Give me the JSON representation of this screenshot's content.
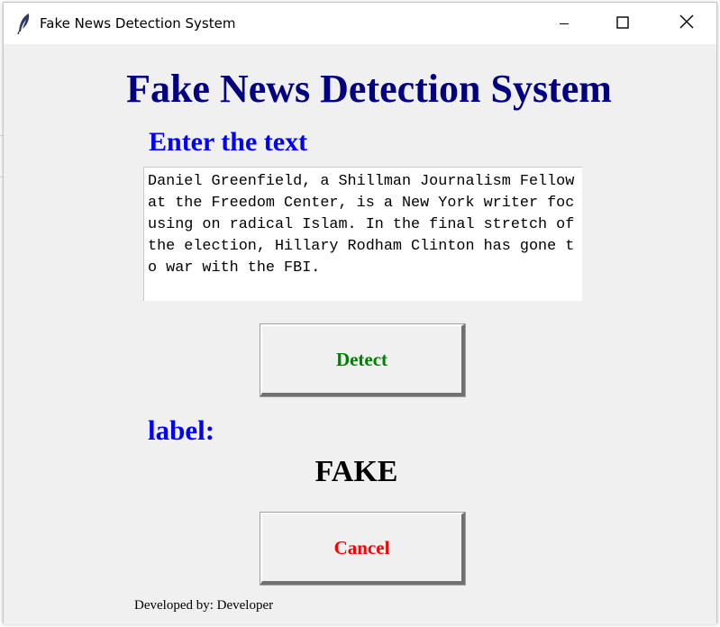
{
  "window": {
    "title": "Fake News Detection System",
    "minimize_icon": "minimize-icon",
    "maximize_icon": "maximize-icon",
    "close_icon": "close-icon",
    "app_icon": "feather-icon"
  },
  "app": {
    "heading": "Fake News Detection System",
    "input_label": "Enter the text",
    "input_text": "Daniel Greenfield, a Shillman Journalism Fellow at the Freedom Center, is a New York writer focusing on radical Islam. In the final stretch of the election, Hillary Rodham Clinton has gone to war with the FBI.",
    "detect_label": "Detect",
    "result_heading": "label:",
    "result_value": "FAKE",
    "cancel_label": "Cancel",
    "footer": "Developed by: Developer"
  },
  "colors": {
    "heading": "#000080",
    "labels": "#0000ff",
    "detect": "#008000",
    "cancel": "#ff0000",
    "background": "#f0f0f0"
  }
}
